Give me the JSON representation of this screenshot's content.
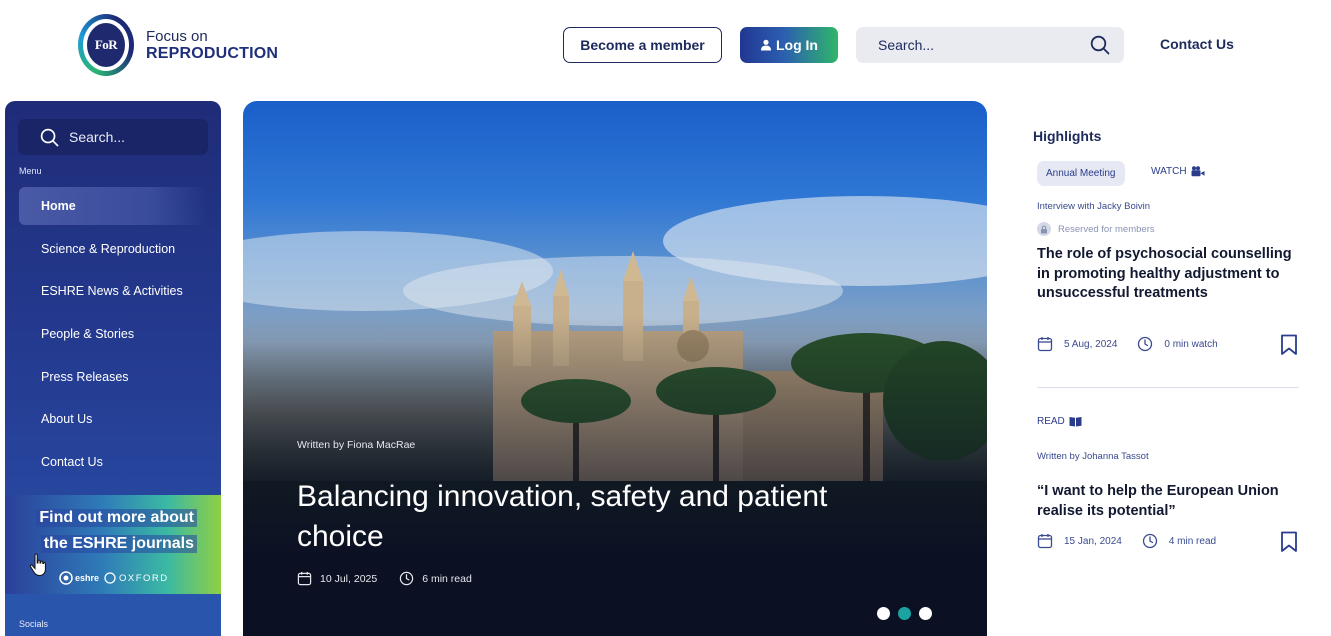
{
  "header": {
    "logo_line1": "Focus on",
    "logo_line2": "REPRODUCTION",
    "logo_mark_text": "FoR",
    "become_member_label": "Become a member",
    "login_label": "Log In",
    "search_placeholder": "Search...",
    "contact_label": "Contact Us"
  },
  "sidebar": {
    "search_placeholder": "Search...",
    "menu_caption": "Menu",
    "items": [
      {
        "label": "Home",
        "active": true
      },
      {
        "label": "Science & Reproduction"
      },
      {
        "label": "ESHRE News & Activities"
      },
      {
        "label": "People & Stories"
      },
      {
        "label": "Press Releases"
      },
      {
        "label": "About Us"
      },
      {
        "label": "Contact Us"
      }
    ],
    "promo": {
      "line1": "Find out more about",
      "line2": "the ESHRE journals",
      "eshre_logo": "eshre",
      "oxford_logo": "OXFORD"
    },
    "socials_label": "Socials"
  },
  "hero": {
    "author": "Written by Fiona MacRae",
    "title": "Balancing innovation, safety and patient choice",
    "date": "10 Jul, 2025",
    "read_time": "6 min read",
    "slides": 3,
    "active_slide": 2
  },
  "highlights": {
    "title": "Highlights",
    "card1": {
      "tag": "Annual Meeting",
      "type": "WATCH",
      "subtitle": "Interview with Jacky Boivin",
      "reserved": "Reserved for members",
      "title": "The role of psychosocial counselling in promoting healthy adjustment to unsuccessful treatments",
      "date": "5 Aug, 2024",
      "duration": "0 min watch"
    },
    "card2": {
      "type": "READ",
      "author": "Written by Johanna Tassot",
      "title": "“I want to help the European Union realise its potential”",
      "date": "15 Jan, 2024",
      "duration": "4 min read"
    }
  },
  "colors": {
    "navy": "#1d2a5c",
    "sidebar": "#243a8f",
    "accent_green": "#2fb66a",
    "teal_dot": "#1aa3a0"
  }
}
